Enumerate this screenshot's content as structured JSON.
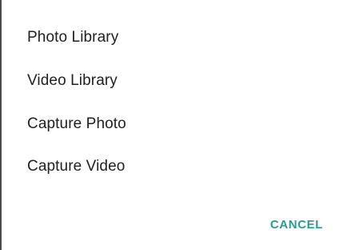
{
  "dialog": {
    "options": [
      {
        "label": "Photo Library"
      },
      {
        "label": "Video Library"
      },
      {
        "label": "Capture Photo"
      },
      {
        "label": "Capture Video"
      }
    ],
    "cancel_label": "CANCEL"
  },
  "colors": {
    "accent": "#2a9d8f",
    "text": "#212121",
    "background": "#ffffff"
  }
}
